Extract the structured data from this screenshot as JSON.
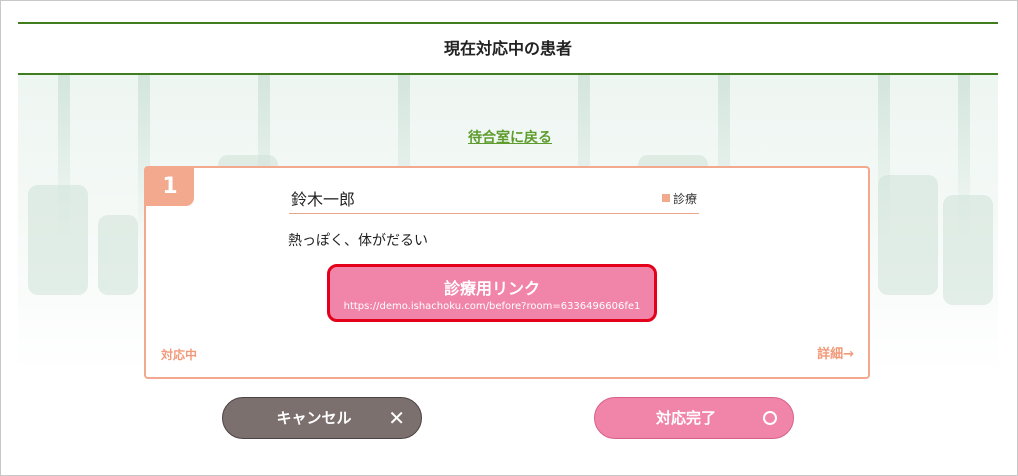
{
  "header": {
    "title": "現在対応中の患者"
  },
  "back_link": "待合室に戻る",
  "card": {
    "number": "1",
    "patient_name": "鈴木一郎",
    "type_label": "診療",
    "symptom": "熱っぽく、体がだるい",
    "link_button": {
      "label": "診療用リンク",
      "url": "https://demo.ishachoku.com/before?room=6336496606fe1"
    },
    "status": "対応中",
    "detail_link": "詳細→"
  },
  "actions": {
    "cancel_label": "キャンセル",
    "cancel_icon": "✕",
    "done_label": "対応完了"
  },
  "colors": {
    "header_rule": "#3f7d1e",
    "accent_salmon": "#f3a98d",
    "link_button_bg": "#f185a9",
    "link_button_border": "#e4001a",
    "cancel_bg": "#7c706f"
  }
}
